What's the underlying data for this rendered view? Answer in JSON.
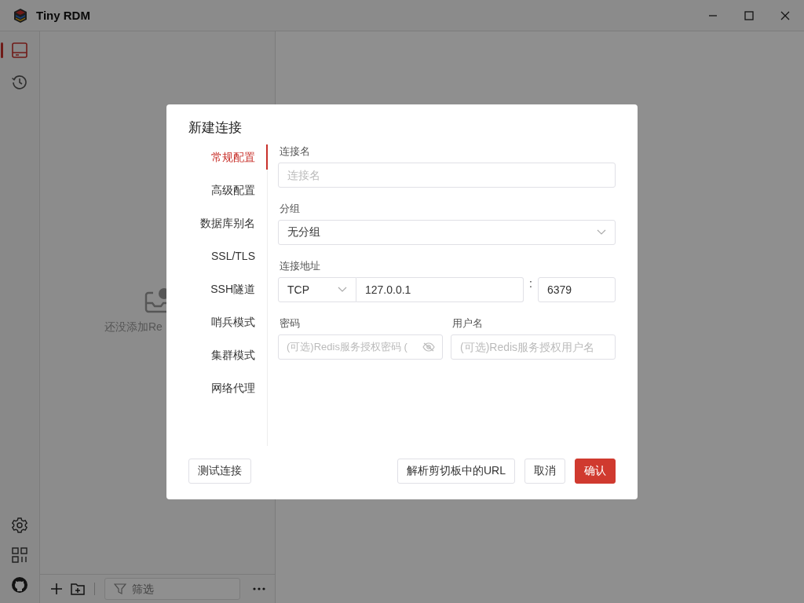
{
  "window": {
    "title": "Tiny RDM"
  },
  "ribbon": {
    "top": [
      {
        "kind": "server",
        "selected": true
      },
      {
        "kind": "history",
        "selected": false
      }
    ],
    "bottom": [
      {
        "kind": "settings"
      },
      {
        "kind": "apps"
      },
      {
        "kind": "github"
      }
    ]
  },
  "sidebar": {
    "empty_text": "还没添加Re",
    "filter": {
      "placeholder": "筛选"
    }
  },
  "dialog": {
    "title": "新建连接",
    "tabs": [
      {
        "label": "常规配置",
        "selected": true
      },
      {
        "label": "高级配置",
        "selected": false
      },
      {
        "label": "数据库别名",
        "selected": false
      },
      {
        "label": "SSL/TLS",
        "selected": false
      },
      {
        "label": "SSH隧道",
        "selected": false
      },
      {
        "label": "哨兵模式",
        "selected": false
      },
      {
        "label": "集群模式",
        "selected": false
      },
      {
        "label": "网络代理",
        "selected": false
      }
    ],
    "name": {
      "label": "连接名",
      "placeholder": "连接名"
    },
    "group": {
      "label": "分组",
      "value": "无分组"
    },
    "address": {
      "label": "连接地址",
      "protocol": "TCP",
      "host": "127.0.0.1",
      "separator": ":",
      "port": "6379"
    },
    "password": {
      "label": "密码",
      "placeholder": "(可选)Redis服务授权密码 ("
    },
    "username": {
      "label": "用户名",
      "placeholder": "(可选)Redis服务授权用户名"
    },
    "buttons_left": [
      {
        "label": "测试连接",
        "primary": false
      }
    ],
    "buttons_right": [
      {
        "label": "解析剪切板中的URL",
        "primary": false
      },
      {
        "label": "取消",
        "primary": false
      },
      {
        "label": "确认",
        "primary": true
      }
    ]
  }
}
